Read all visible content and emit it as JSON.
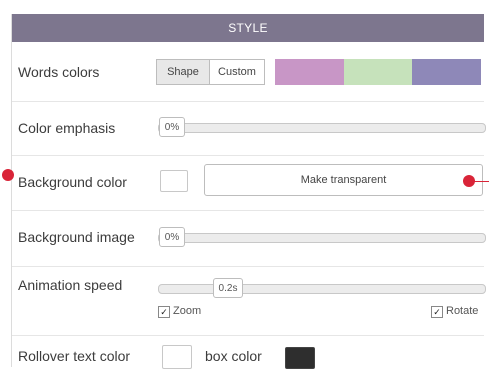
{
  "header": {
    "title": "STYLE"
  },
  "words_colors": {
    "label": "Words colors",
    "shape_label": "Shape",
    "custom_label": "Custom",
    "palette": [
      "#c896c6",
      "#c6e2bb",
      "#8e88b8"
    ]
  },
  "color_emphasis": {
    "label": "Color emphasis",
    "value": "0%"
  },
  "background_color": {
    "label": "Background color",
    "button_label": "Make transparent"
  },
  "background_image": {
    "label": "Background image",
    "value": "0%"
  },
  "animation_speed": {
    "label": "Animation speed",
    "value": "0.2s",
    "zoom_label": "Zoom",
    "zoom_checked": true,
    "rotate_label": "Rotate",
    "rotate_checked": true
  },
  "rollover": {
    "label": "Rollover text color",
    "box_color_label": "box color",
    "box_color": "#2e2e2e"
  },
  "accent_color": "#d92438",
  "header_color": "#7d768e"
}
